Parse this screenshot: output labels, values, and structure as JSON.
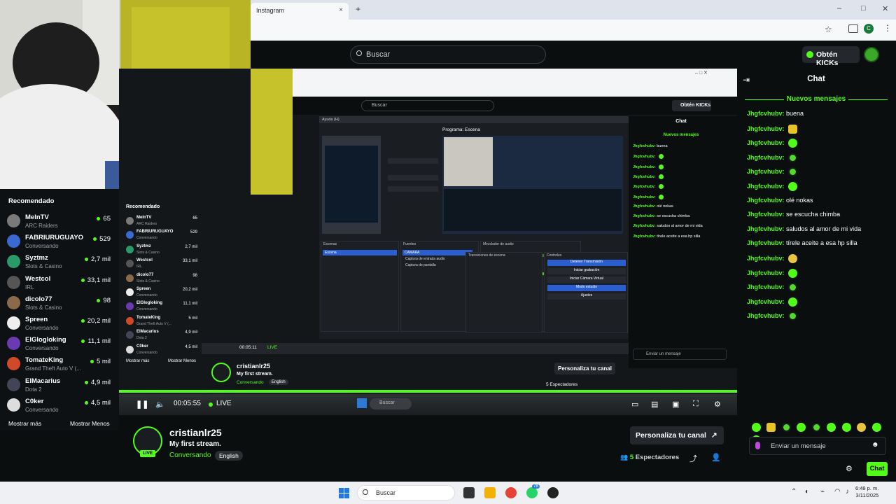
{
  "browser": {
    "tab_title": "Instagram",
    "tab_close": "×",
    "new_tab": "+",
    "window_min": "–",
    "window_max": "□",
    "window_close": "✕",
    "profile_initial": "C"
  },
  "header": {
    "search_placeholder": "Buscar",
    "kicks_button": "Obtén KICKs"
  },
  "sidebar": {
    "title": "Recomendado",
    "items": [
      {
        "name": "MelnTV",
        "sub": "ARC Raiders",
        "viewers": "65"
      },
      {
        "name": "FABRIURUGUAYO",
        "sub": "Conversando",
        "viewers": "529"
      },
      {
        "name": "Syztmz",
        "sub": "Slots & Casino",
        "viewers": "2,7 mil"
      },
      {
        "name": "Westcol",
        "sub": "IRL",
        "viewers": "33,1 mil"
      },
      {
        "name": "dicolo77",
        "sub": "Slots & Casino",
        "viewers": "98"
      },
      {
        "name": "Spreen",
        "sub": "Conversando",
        "viewers": "20,2 mil"
      },
      {
        "name": "ElGlogloking",
        "sub": "Conversando",
        "viewers": "11,1 mil"
      },
      {
        "name": "TomateKing",
        "sub": "Grand Theft Auto V (...",
        "viewers": "5 mil"
      },
      {
        "name": "ElMacarius",
        "sub": "Dota 2",
        "viewers": "4,9 mil"
      },
      {
        "name": "C0ker",
        "sub": "Conversando",
        "viewers": "4,5 mil"
      }
    ],
    "show_more": "Mostrar más",
    "show_less": "Mostrar Menos"
  },
  "inner_mirror": {
    "search": "Buscar",
    "kicks": "Obtén KICKs",
    "chat_title": "Chat",
    "new_messages": "Nuevos mensajes",
    "preview_label": "Ayuda (H)",
    "program_label": "Programa: Escena",
    "scenes_label": "Escenas",
    "sources_label": "Fuentes",
    "mixer_label": "Mezclador de audio",
    "transitions_label": "Transiciones de escena",
    "controls_label": "Controles",
    "scene_name": "Escena",
    "source_1": "CAMARA",
    "source_2": "Captura de entrada audio",
    "source_3": "Captura de pantalla",
    "btn_stop": "Detener Transmisión",
    "btn_record": "Iniciar grabación",
    "btn_vcam": "Iniciar Cámara Virtual",
    "btn_studio": "Modo estudio",
    "btn_settings": "Ajustes",
    "time": "00:05:11",
    "live": "LIVE",
    "streamer": "cristianlr25",
    "stream_title": "My first stream.",
    "category": "Conversando",
    "language": "English",
    "viewers": "5 Espectadores",
    "personalize": "Personaliza tu canal",
    "chat_placeholder": "Enviar un mensaje",
    "send": "Chat",
    "show_more": "Mostrar más",
    "show_less": "Mostrar Menos"
  },
  "player": {
    "time": "00:05:55",
    "live": "LIVE",
    "taskbar_search": "Buscar"
  },
  "stream_info": {
    "streamer": "cristianlr25",
    "title": "My first stream.",
    "category": "Conversando",
    "language": "English",
    "viewers_count": "5",
    "viewers_label": "Espectadores",
    "personalize": "Personaliza tu canal",
    "live": "LIVE"
  },
  "chat": {
    "title": "Chat",
    "new_messages": "Nuevos mensajes",
    "messages": [
      {
        "user": "Jhgfcvhubv:",
        "text": "buena",
        "emote": ""
      },
      {
        "user": "Jhgfcvhubv:",
        "text": "",
        "emote": "yel"
      },
      {
        "user": "Jhgfcvhubv:",
        "text": "",
        "emote": "green"
      },
      {
        "user": "Jhgfcvhubv:",
        "text": "",
        "emote": "dark"
      },
      {
        "user": "Jhgfcvhubv:",
        "text": "",
        "emote": "dark"
      },
      {
        "user": "Jhgfcvhubv:",
        "text": "",
        "emote": "green"
      },
      {
        "user": "Jhgfcvhubv:",
        "text": "olé nokas",
        "emote": ""
      },
      {
        "user": "Jhgfcvhubv:",
        "text": "se escucha chimba",
        "emote": ""
      },
      {
        "user": "Jhgfcvhubv:",
        "text": "saludos al amor de mi vida",
        "emote": ""
      },
      {
        "user": "Jhgfcvhubv:",
        "text": "tírele aceite a esa hp silla",
        "emote": ""
      },
      {
        "user": "Jhgfcvhubv:",
        "text": "",
        "emote": "face"
      },
      {
        "user": "Jhgfcvhubv:",
        "text": "",
        "emote": "green"
      },
      {
        "user": "Jhgfcvhubv:",
        "text": "",
        "emote": "dark"
      },
      {
        "user": "Jhgfcvhubv:",
        "text": "",
        "emote": "green"
      },
      {
        "user": "Jhgfcvhubv:",
        "text": "",
        "emote": "dark"
      }
    ],
    "input_placeholder": "Enviar un mensaje",
    "send_button": "Chat"
  },
  "taskbar": {
    "search": "Buscar",
    "time": "6:48 p. m.",
    "date": "3/11/2025",
    "badge": "78"
  },
  "colors": {
    "accent": "#53fc18",
    "background": "#0b0e0f"
  }
}
